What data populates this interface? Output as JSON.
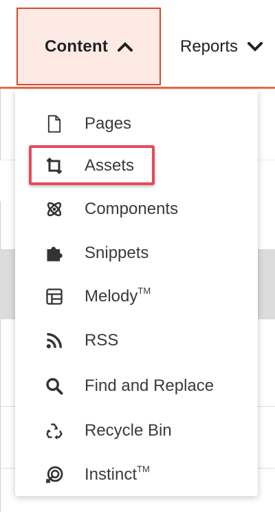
{
  "nav": {
    "content_label": "Content",
    "reports_label": "Reports",
    "content_chevron": "chevron-up-icon",
    "reports_chevron": "chevron-down-icon"
  },
  "dropdown": {
    "items": [
      {
        "label": "Pages",
        "icon": "page-icon"
      },
      {
        "label": "Assets",
        "icon": "assets-icon"
      },
      {
        "label": "Components",
        "icon": "components-icon"
      },
      {
        "label": "Snippets",
        "icon": "puzzle-icon"
      },
      {
        "label": "Melody",
        "sup": "TM",
        "icon": "layout-icon"
      },
      {
        "label": "RSS",
        "icon": "rss-icon"
      },
      {
        "label": "Find and Replace",
        "icon": "search-icon"
      },
      {
        "label": "Recycle Bin",
        "icon": "recycle-icon"
      },
      {
        "label": "Instinct",
        "sup": "TM",
        "icon": "instinct-icon"
      }
    ]
  },
  "colors": {
    "accent": "#e8694b",
    "active_tab_bg": "#fdeae4",
    "highlight": "#e84a5a"
  }
}
